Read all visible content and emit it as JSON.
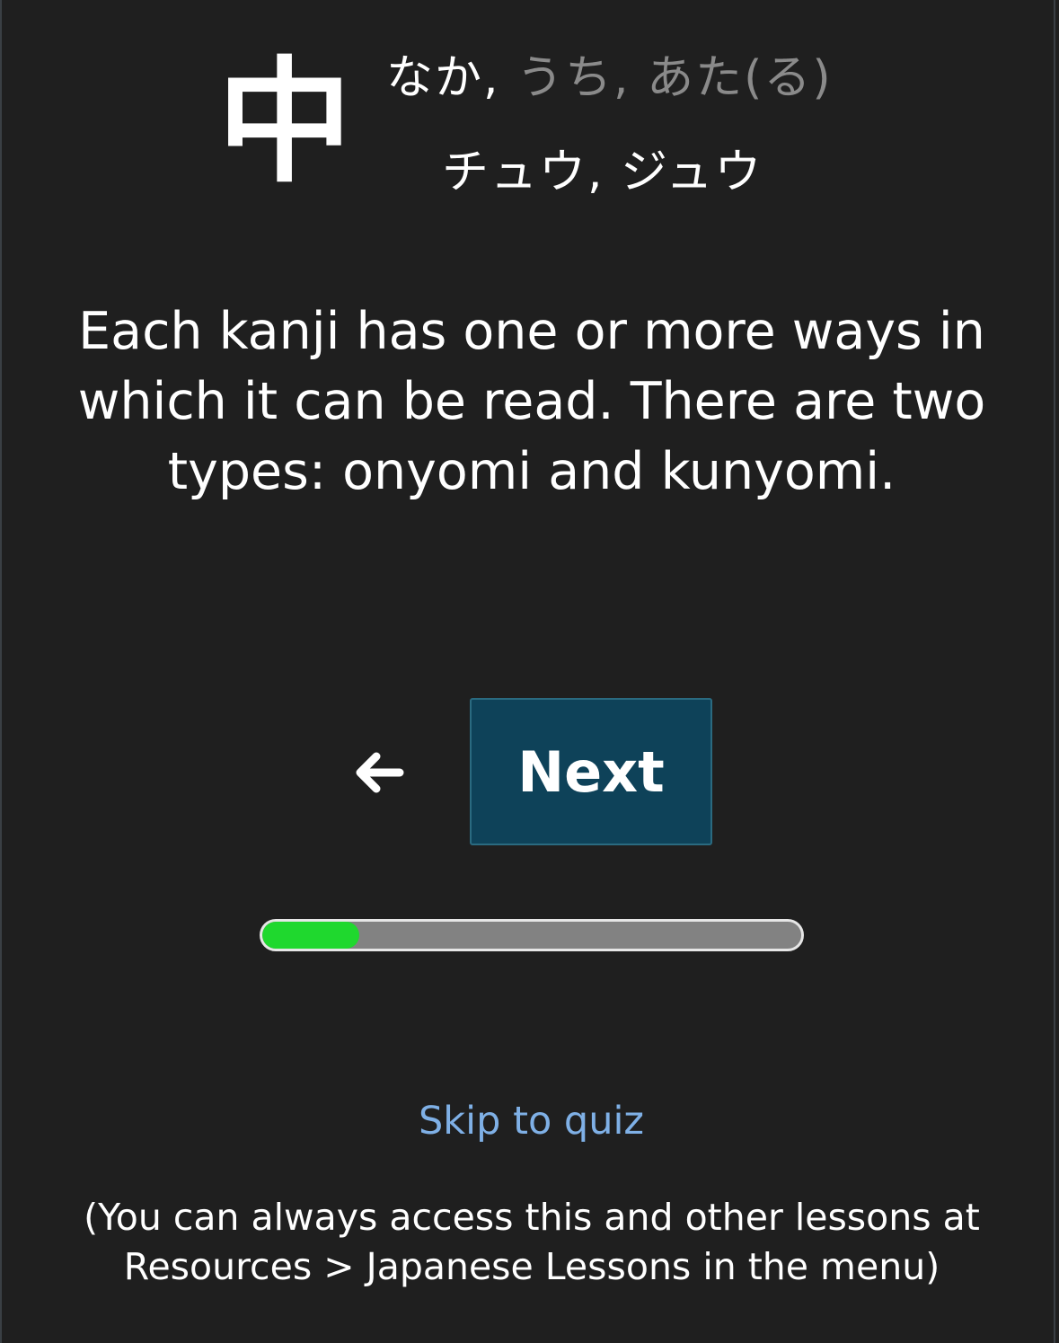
{
  "kanji": {
    "character": "中",
    "kunyomi_primary": "なか,",
    "kunyomi_secondary": " うち, あた(る)",
    "onyomi": "チュウ, ジュウ"
  },
  "lesson": {
    "explanation": "Each kanji has one or more ways in which it can be read. There are two types: onyomi and kunyomi."
  },
  "controls": {
    "back_icon": "arrow-left-icon",
    "next_label": "Next"
  },
  "progress": {
    "fraction": 0.18,
    "fill_color": "#1fd82e",
    "track_color": "#828282"
  },
  "skip": {
    "label": "Skip to quiz"
  },
  "footer": {
    "note": "(You can always access this and other lessons at Resources > Japanese Lessons in the menu)"
  },
  "colors": {
    "background": "#1f1f1f",
    "button_bg": "#0e4259",
    "link": "#7fb0e6",
    "muted_reading": "#8a8a8a"
  }
}
